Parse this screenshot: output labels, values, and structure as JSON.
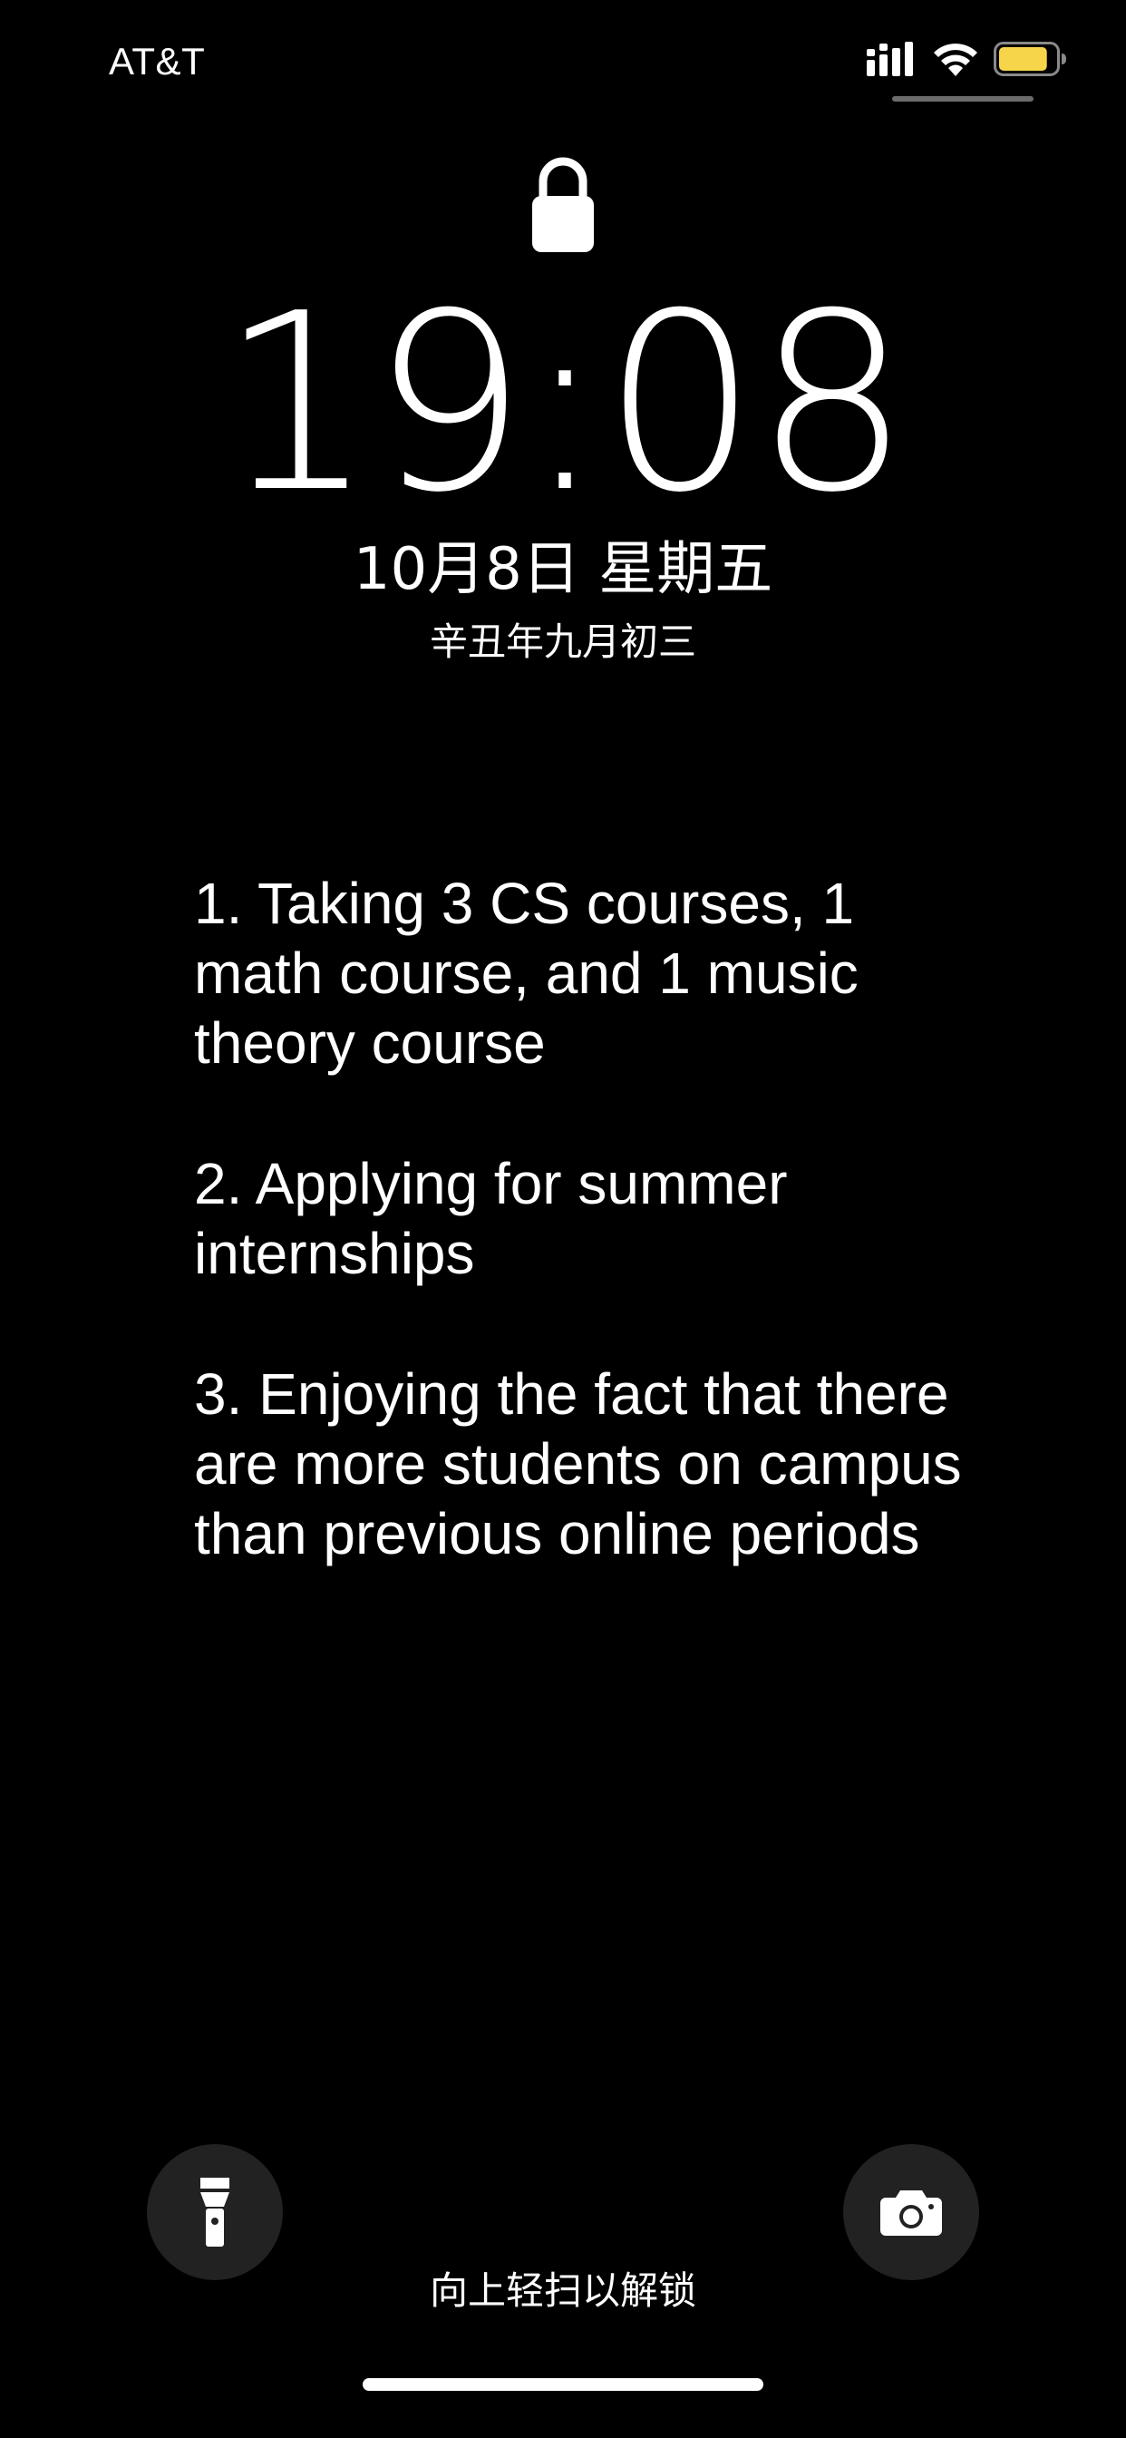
{
  "status_bar": {
    "carrier": "AT&T",
    "signal_icon": "cellular-signal-icon",
    "wifi_icon": "wifi-icon",
    "battery_icon": "battery-icon",
    "battery_color": "#F7D54A",
    "battery_level_fraction": 0.85
  },
  "lock_screen": {
    "lock_icon": "lock-icon",
    "time": "19:08",
    "date": "10月8日 星期五",
    "lunar_date": "辛丑年九月初三"
  },
  "notes": [
    "1. Taking 3 CS courses, 1\nmath course, and 1 music\ntheory course",
    "2. Applying for summer\ninternships",
    "3. Enjoying the fact that there\nare more students on campus\nthan previous online periods"
  ],
  "bottom": {
    "flashlight_icon": "flashlight-icon",
    "camera_icon": "camera-icon",
    "unlock_hint": "向上轻扫以解锁"
  }
}
